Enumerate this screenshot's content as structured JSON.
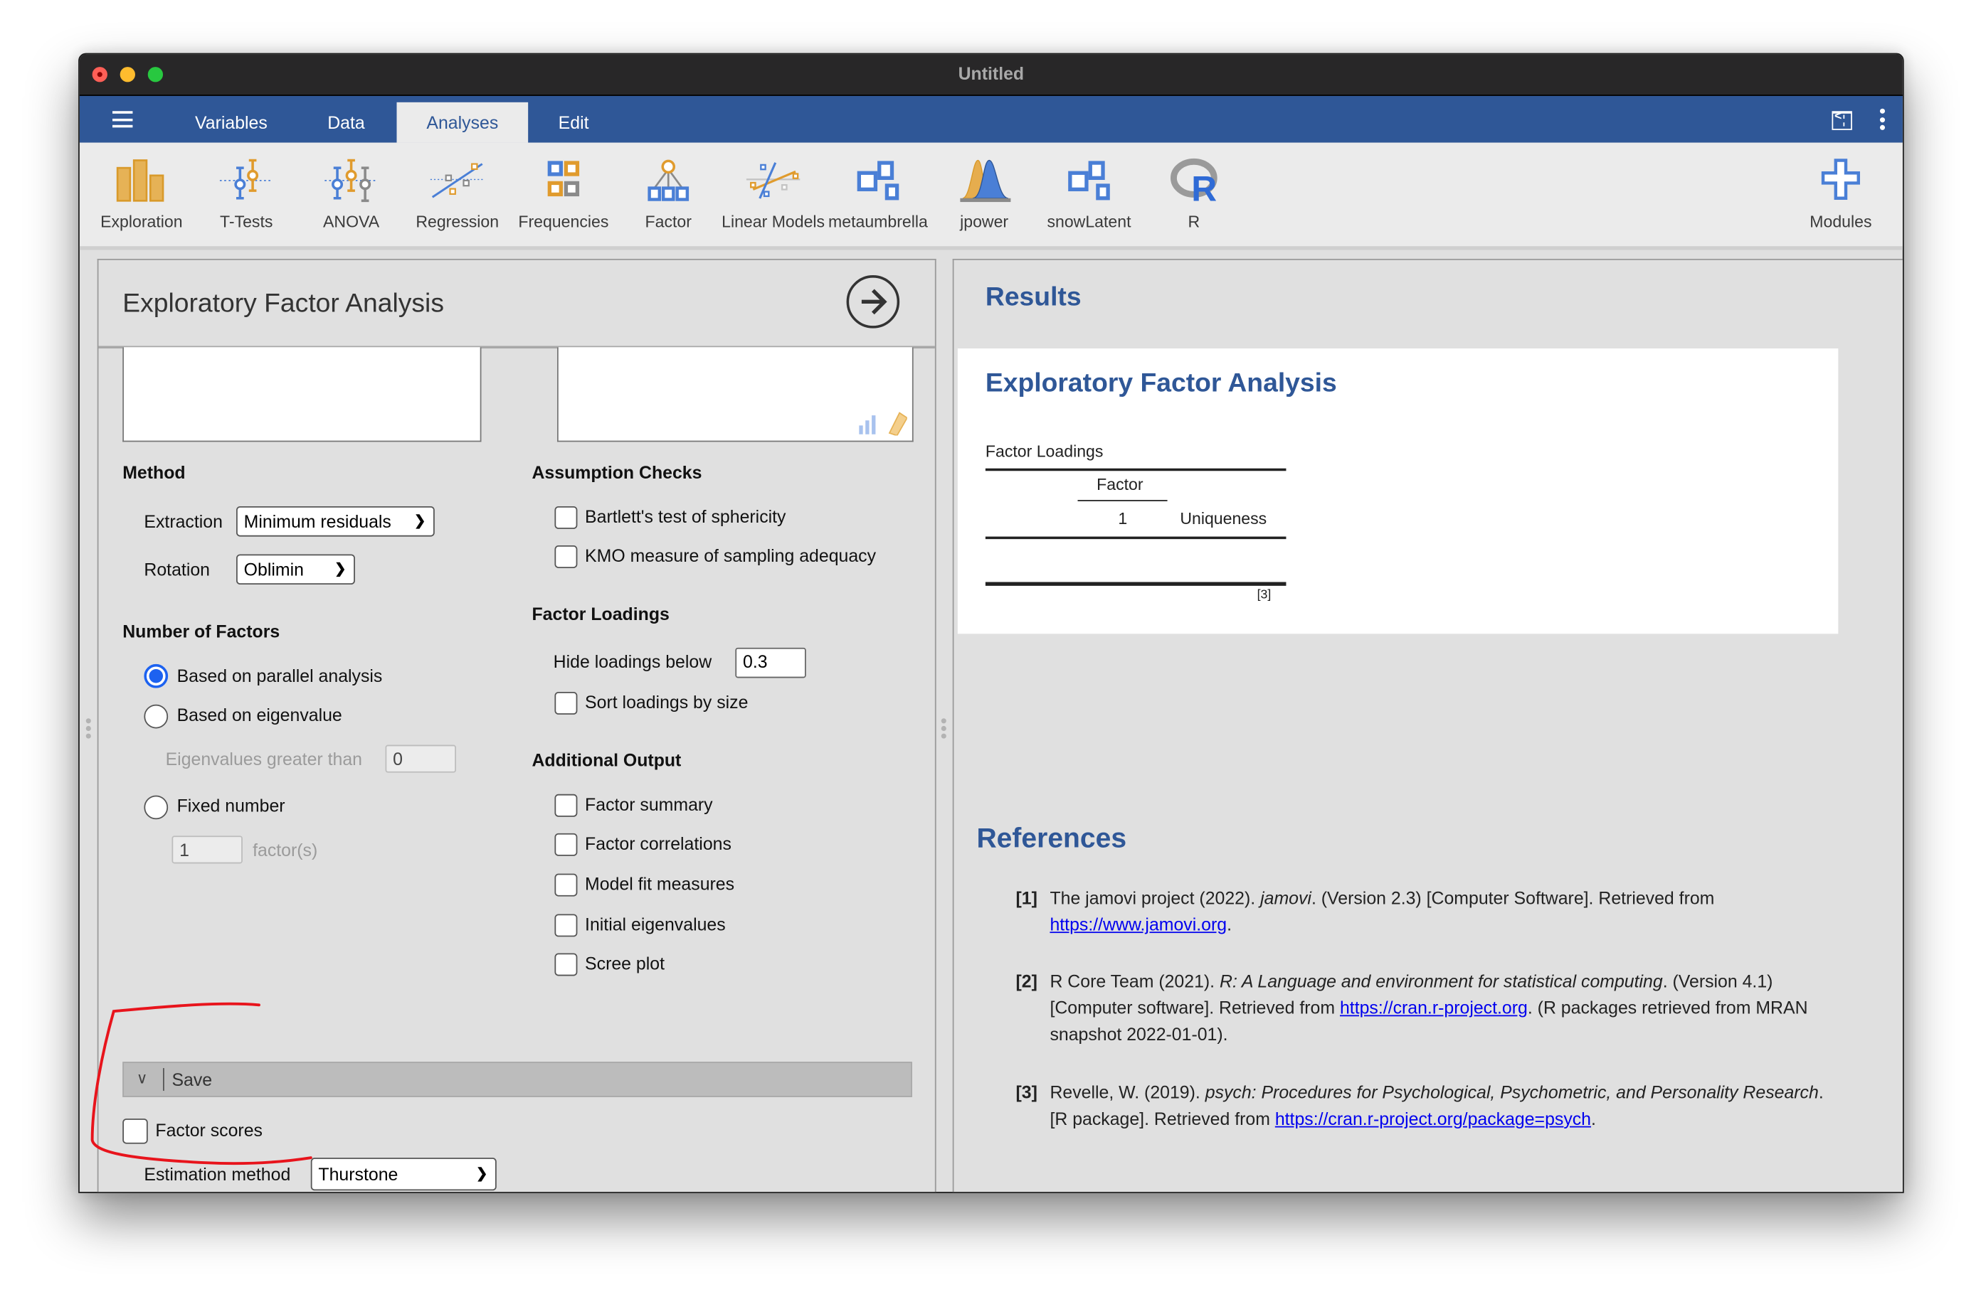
{
  "window": {
    "title": "Untitled"
  },
  "tabs": [
    {
      "label": "Variables",
      "active": false
    },
    {
      "label": "Data",
      "active": false
    },
    {
      "label": "Analyses",
      "active": true
    },
    {
      "label": "Edit",
      "active": false
    }
  ],
  "header_icons": {
    "menu": "hamburger-menu-icon",
    "collapse": "collapse-panel-icon",
    "more": "kebab-menu-icon"
  },
  "toolbar": {
    "items": [
      {
        "label": "Exploration",
        "icon": "bar-chart-icon"
      },
      {
        "label": "T-Tests",
        "icon": "ttest-icon"
      },
      {
        "label": "ANOVA",
        "icon": "anova-icon"
      },
      {
        "label": "Regression",
        "icon": "regression-icon"
      },
      {
        "label": "Frequencies",
        "icon": "frequencies-icon"
      },
      {
        "label": "Factor",
        "icon": "factor-tree-icon"
      },
      {
        "label": "Linear Models",
        "icon": "linear-models-icon"
      },
      {
        "label": "metaumbrella",
        "icon": "squares-icon"
      },
      {
        "label": "jpower",
        "icon": "distributions-icon"
      },
      {
        "label": "snowLatent",
        "icon": "squares-icon"
      },
      {
        "label": "R",
        "icon": "r-logo-icon"
      }
    ],
    "modules_label": "Modules"
  },
  "options_panel": {
    "title": "Exploratory Factor Analysis",
    "method": {
      "heading": "Method",
      "extraction_label": "Extraction",
      "extraction_value": "Minimum residuals",
      "rotation_label": "Rotation",
      "rotation_value": "Oblimin"
    },
    "number_of_factors": {
      "heading": "Number of Factors",
      "options": [
        {
          "label": "Based on parallel analysis",
          "selected": true
        },
        {
          "label": "Based on eigenvalue",
          "selected": false
        },
        {
          "label": "Fixed number",
          "selected": false
        }
      ],
      "eigen_label": "Eigenvalues greater than",
      "eigen_value": "0",
      "fixed_value": "1",
      "fixed_suffix": "factor(s)"
    },
    "assumption_checks": {
      "heading": "Assumption Checks",
      "items": [
        {
          "label": "Bartlett's test of sphericity",
          "checked": false
        },
        {
          "label": "KMO measure of sampling adequacy",
          "checked": false
        }
      ]
    },
    "factor_loadings": {
      "heading": "Factor Loadings",
      "hide_label": "Hide loadings below",
      "hide_value": "0.3",
      "sort_label": "Sort loadings by size",
      "sort_checked": false
    },
    "additional_output": {
      "heading": "Additional Output",
      "items": [
        {
          "label": "Factor summary",
          "checked": false
        },
        {
          "label": "Factor correlations",
          "checked": false
        },
        {
          "label": "Model fit measures",
          "checked": false
        },
        {
          "label": "Initial eigenvalues",
          "checked": false
        },
        {
          "label": "Scree plot",
          "checked": false
        }
      ]
    },
    "save": {
      "label": "Save",
      "factor_scores_label": "Factor scores",
      "factor_scores_checked": false,
      "estimation_label": "Estimation method",
      "estimation_value": "Thurstone"
    }
  },
  "results": {
    "heading": "Results",
    "analysis_title": "Exploratory Factor Analysis",
    "table": {
      "caption": "Factor Loadings",
      "group_header": "Factor",
      "columns": [
        "1",
        "Uniqueness"
      ],
      "rows": [],
      "footnote": "[3]"
    },
    "references_heading": "References",
    "references": [
      {
        "num": "[1]",
        "pre": "The jamovi project (2022). ",
        "italic": "jamovi",
        "post": ". (Version 2.3) [Computer Software]. Retrieved from ",
        "link": "https://www.jamovi.org",
        "tail": "."
      },
      {
        "num": "[2]",
        "pre": "R Core Team (2021). ",
        "italic": "R: A Language and environment for statistical computing",
        "post": ". (Version 4.1) [Computer software]. Retrieved from ",
        "link": "https://cran.r-project.org",
        "tail": ". (R packages retrieved from MRAN snapshot 2022-01-01)."
      },
      {
        "num": "[3]",
        "pre": "Revelle, W. (2019). ",
        "italic": "psych: Procedures for Psychological, Psychometric, and Personality Research",
        "post": ". [R package]. Retrieved from ",
        "link": "https://cran.r-project.org/package=psych",
        "tail": "."
      }
    ]
  },
  "colors": {
    "brand_blue": "#2f5797",
    "radio_selected": "#1d62f0",
    "annotation_red": "#e8141c",
    "link": "#0000ee"
  }
}
